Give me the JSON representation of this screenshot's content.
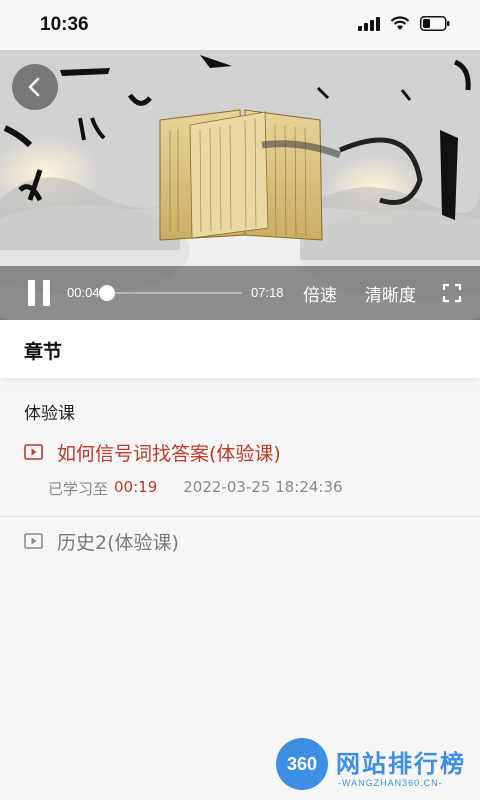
{
  "status_bar": {
    "time": "10:36"
  },
  "player": {
    "current_time": "00:04",
    "total_time": "07:18",
    "progress_fraction": 0.009,
    "speed_label": "倍速",
    "quality_label": "清晰度"
  },
  "chapter": {
    "title": "章节"
  },
  "section": {
    "title": "体验课",
    "lessons": [
      {
        "title": "如何信号词找答案(体验课)",
        "learned_prefix": "已学习至",
        "learned_time": "00:19",
        "date": "2022-03-25 18:24:36",
        "active": true
      },
      {
        "title": "历史2(体验课)",
        "active": false
      }
    ]
  },
  "watermark": {
    "badge": "360",
    "name": "网站排行榜",
    "domain": "-WANGZHAN360.CN-"
  },
  "colors": {
    "accent": "#c0392b",
    "watermark": "#3d8fe6"
  },
  "icons": [
    "back-icon",
    "pause-icon",
    "fullscreen-icon",
    "play-icon",
    "signal-icon",
    "wifi-icon",
    "battery-icon"
  ]
}
